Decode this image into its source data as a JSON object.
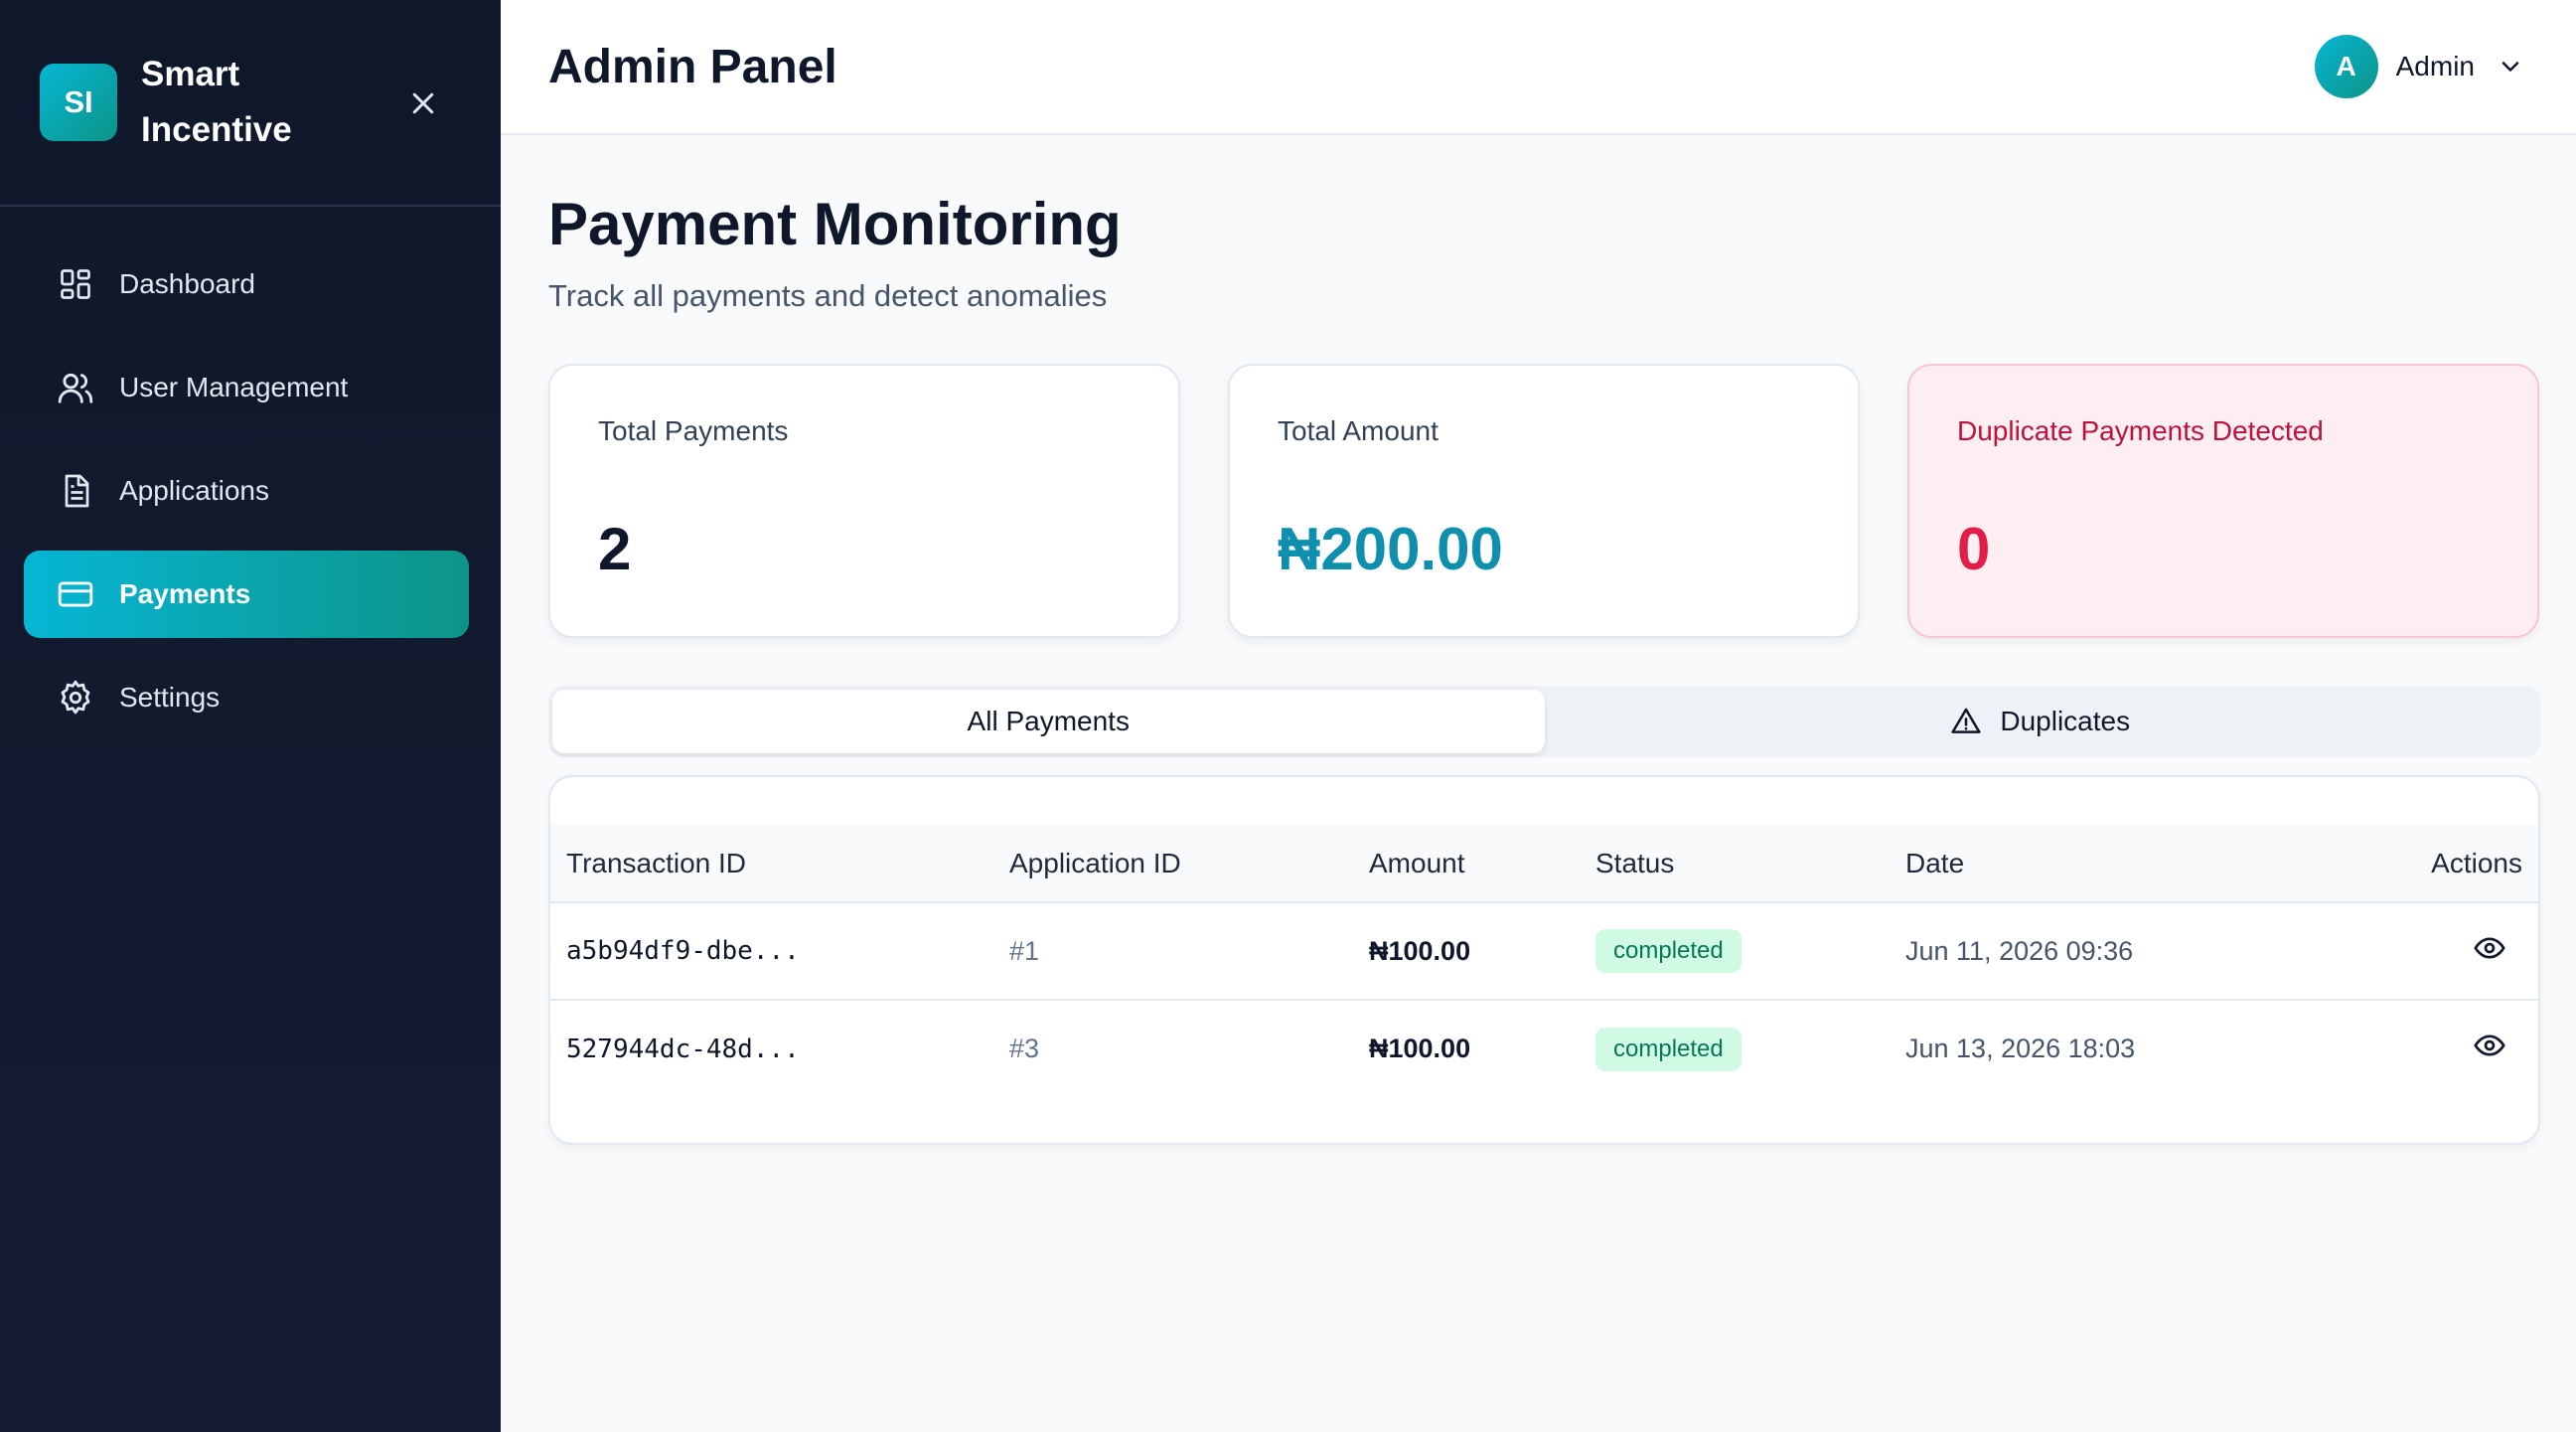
{
  "sidebar": {
    "logo_text": "SI",
    "brand_line1": "Smart",
    "brand_line2": "Incentive",
    "items": [
      {
        "label": "Dashboard",
        "icon": "dashboard-grid-icon"
      },
      {
        "label": "User Management",
        "icon": "users-icon"
      },
      {
        "label": "Applications",
        "icon": "document-icon"
      },
      {
        "label": "Payments",
        "icon": "credit-card-icon",
        "active": true
      },
      {
        "label": "Settings",
        "icon": "gear-icon"
      }
    ]
  },
  "header": {
    "title": "Admin Panel",
    "avatar_letter": "A",
    "user_name": "Admin"
  },
  "page": {
    "title": "Payment Monitoring",
    "subtitle": "Track all payments and detect anomalies"
  },
  "stats": {
    "total_payments_label": "Total Payments",
    "total_payments_value": "2",
    "total_amount_label": "Total Amount",
    "total_amount_value": "₦200.00",
    "duplicates_label": "Duplicate Payments Detected",
    "duplicates_value": "0"
  },
  "tabs": {
    "all": "All Payments",
    "duplicates": "Duplicates"
  },
  "table": {
    "columns": [
      "Transaction ID",
      "Application ID",
      "Amount",
      "Status",
      "Date",
      "Actions"
    ],
    "rows": [
      {
        "transaction_id": "a5b94df9-dbe...",
        "application_id": "#1",
        "amount": "₦100.00",
        "status": "completed",
        "date": "Jun 11, 2026 09:36"
      },
      {
        "transaction_id": "527944dc-48d...",
        "application_id": "#3",
        "amount": "₦100.00",
        "status": "completed",
        "date": "Jun 13, 2026 18:03"
      }
    ]
  },
  "colors": {
    "sidebar_bg": "#0f172a",
    "accent": "#06b6d4",
    "accent_end": "#0d9488",
    "amount": "#0e8fad",
    "danger": "#e11d48",
    "status_bg": "#d1fae5",
    "status_text": "#047857"
  }
}
